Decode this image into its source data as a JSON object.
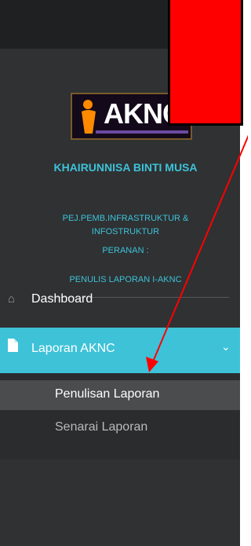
{
  "colors": {
    "sidebar_bg": "#2f3133",
    "topbar_bg": "#1f2021",
    "accent": "#3ec2d8",
    "annotation": "#ff0000"
  },
  "logo": {
    "text": "AKNC"
  },
  "profile": {
    "name": "KHAIRUNNISA BINTI MUSA",
    "position": "PEJ.PEMB.INFRASTRUKTUR & INFOSTRUKTUR",
    "role_label": "PERANAN :",
    "role": "PENULIS LAPORAN I-AKNC"
  },
  "menu": {
    "dashboard": {
      "label": "Dashboard",
      "icon": "home-icon"
    },
    "laporan": {
      "label": "Laporan AKNC",
      "icon": "file-icon",
      "chevron": "chevron-down-icon"
    },
    "submenu": [
      {
        "label": "Penulisan Laporan",
        "active": true
      },
      {
        "label": "Senarai Laporan",
        "active": false
      }
    ]
  }
}
